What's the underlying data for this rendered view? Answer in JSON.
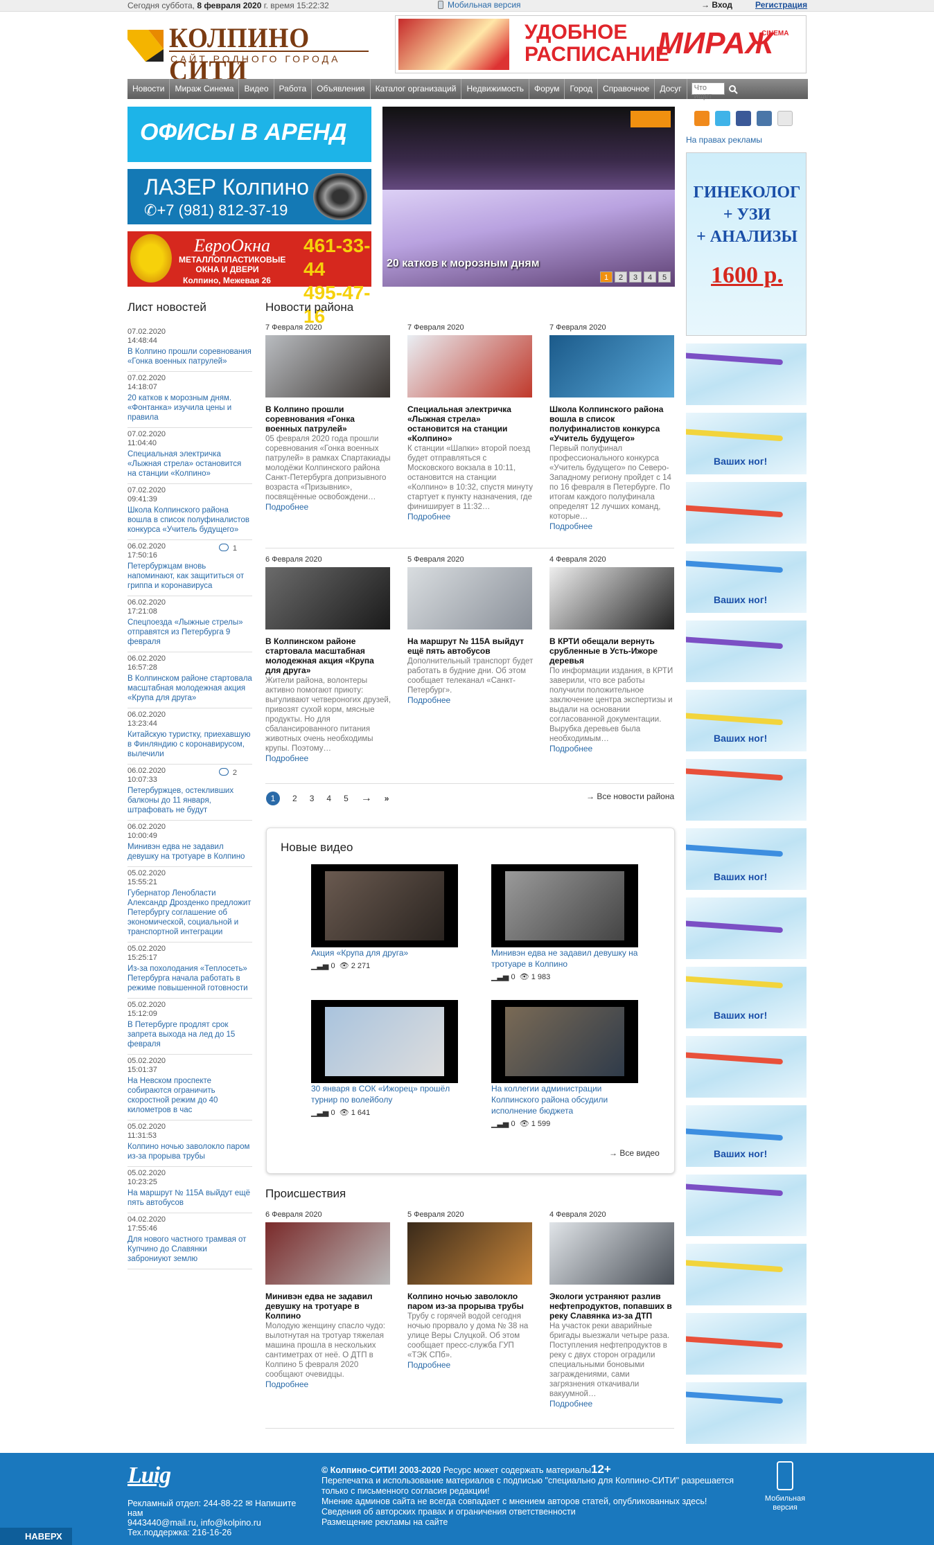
{
  "topbar": {
    "date_prefix": "Сегодня суббота, ",
    "date_bold": "8 февраля 2020",
    "date_suffix": " г. время 15:22:32",
    "mobile": "Мобильная версия",
    "login": "Вход",
    "register": "Регистрация"
  },
  "logo": {
    "title": "КОЛПИНО СИТИ",
    "subtitle": "САЙТ РОДНОГО ГОРОДА"
  },
  "top_ad": {
    "line1": "УДОБНОЕ",
    "line2": "РАСПИСАНИЕ",
    "brand": "МИРАЖ",
    "brand_small": "CINEMA"
  },
  "nav": [
    "Новости",
    "Мираж Синема",
    "Видео",
    "Работа",
    "Объявления",
    "Каталог организаций",
    "Недвижимость",
    "Форум",
    "Город",
    "Справочное",
    "Досуг"
  ],
  "search_placeholder": "Что ищет",
  "banners": {
    "b1": "ОФИСЫ В АРЕНД",
    "b2_l1": "ЛАЗЕР Колпино",
    "b2_l2": "+7 (981) 812-37-19",
    "b3_brand": "ЕвроОкна",
    "b3_text": "МЕТАЛЛОПЛАСТИКОВЫЕ ОКНА И ДВЕРИ",
    "b3_ph1": "461-33-44",
    "b3_ph2": "495-47-16",
    "b3_addr": "Колпино, Межевая 26"
  },
  "slider": {
    "caption": "20 катков к морозным дням",
    "pages": [
      "1",
      "2",
      "3",
      "4",
      "5"
    ]
  },
  "right": {
    "ad_label": "На правах рекламы",
    "ad1_lines": [
      "ГИНЕКОЛОГ",
      "+ УЗИ",
      "+ АНАЛИЗЫ"
    ],
    "ad1_price": "1600 р.",
    "tile_text": "Ваших ног!"
  },
  "left": {
    "title": "Лист новостей",
    "items": [
      {
        "date": "07.02.2020",
        "time": "14:48:44",
        "title": "В Колпино прошли соревнования «Гонка военных патрулей»",
        "comments": ""
      },
      {
        "date": "07.02.2020",
        "time": "14:18:07",
        "title": "20 катков к морозным дням. «Фонтанка» изучила цены и правила",
        "comments": ""
      },
      {
        "date": "07.02.2020",
        "time": "11:04:40",
        "title": "Специальная электричка «Лыжная стрела» остановится на станции «Колпино»",
        "comments": ""
      },
      {
        "date": "07.02.2020",
        "time": "09:41:39",
        "title": "Школа Колпинского района вошла в список полуфиналистов конкурса «Учитель будущего»",
        "comments": ""
      },
      {
        "date": "06.02.2020",
        "time": "17:50:16",
        "title": "Петербуржцам вновь напоминают, как защититься от гриппа и коронавируса",
        "comments": "1"
      },
      {
        "date": "06.02.2020",
        "time": "17:21:08",
        "title": "Спецпоезда «Лыжные стрелы» отправятся из Петербурга 9 февраля",
        "comments": ""
      },
      {
        "date": "06.02.2020",
        "time": "16:57:28",
        "title": "В Колпинском районе стартовала масштабная молодежная акция «Крупа для друга»",
        "comments": ""
      },
      {
        "date": "06.02.2020",
        "time": "13:23:44",
        "title": "Китайскую туристку, приехавшую в Финляндию с коронавирусом, вылечили",
        "comments": ""
      },
      {
        "date": "06.02.2020",
        "time": "10:07:33",
        "title": "Петербуржцев, остекливших балконы до 11 января, штрафовать не будут",
        "comments": "2"
      },
      {
        "date": "06.02.2020",
        "time": "10:00:49",
        "title": "Минивэн едва не задавил девушку на тротуаре в Колпино",
        "comments": ""
      },
      {
        "date": "05.02.2020",
        "time": "15:55:21",
        "title": "Губернатор Ленобласти Александр Дрозденко предложит Петербургу соглашение об экономической, социальной и транспортной интеграции",
        "comments": ""
      },
      {
        "date": "05.02.2020",
        "time": "15:25:17",
        "title": "Из-за похолодания «Теплосеть» Петербурга начала работать в режиме повышенной готовности",
        "comments": ""
      },
      {
        "date": "05.02.2020",
        "time": "15:12:09",
        "title": "В Петербурге продлят срок запрета выхода на лед до 15 февраля",
        "comments": ""
      },
      {
        "date": "05.02.2020",
        "time": "15:01:37",
        "title": "На Невском проспекте собираются ограничить скоростной режим до 40 километров в час",
        "comments": ""
      },
      {
        "date": "05.02.2020",
        "time": "11:31:53",
        "title": "Колпино ночью заволокло паром из-за прорыва трубы",
        "comments": ""
      },
      {
        "date": "05.02.2020",
        "time": "10:23:25",
        "title": "На маршрут № 115А выйдут ещё пять автобусов",
        "comments": ""
      },
      {
        "date": "04.02.2020",
        "time": "17:55:46",
        "title": "Для нового частного трамвая от Купчино до Славянки заброниуют землю",
        "comments": ""
      }
    ]
  },
  "district": {
    "title": "Новости района",
    "more": "Подробнее",
    "all": "Все новости района",
    "pages": [
      "2",
      "3",
      "4",
      "5",
      "→",
      "»"
    ],
    "current": "1",
    "cards": [
      {
        "date": "7 Февраля 2020",
        "title": "В Колпино прошли соревнования «Гонка военных патрулей»",
        "text": "05 февраля 2020 года прошли соревнования «Гонка военных патрулей» в рамках Спартакиады молодёжи Колпинского района Санкт-Петербурга допризывного возраста «Призывник», посвящённые освобождени…",
        "img": [
          "#b9bcc0",
          "#3a3430"
        ]
      },
      {
        "date": "7 Февраля 2020",
        "title": "Специальная электричка «Лыжная стрела» остановится на станции «Колпино»",
        "text": "К станции «Шапки» второй поезд будет отправляться с Московского вокзала в 10:11, остановится на станции «Колпино» в 10:32, спустя минуту стартует к пункту назначения, где финиширует в 11:32…",
        "img": [
          "#e9eef3",
          "#c0392b"
        ]
      },
      {
        "date": "7 Февраля 2020",
        "title": "Школа Колпинского района вошла в список полуфиналистов конкурса «Учитель будущего»",
        "text": "Первый полуфинал профессионального конкурса «Учитель будущего» по Северо-Западному региону пройдет с 14 по 16 февраля в Петербурге. По итогам каждого полуфинала определят 12 лучших команд, которые…",
        "img": [
          "#1b5a8a",
          "#59a8d8"
        ]
      },
      {
        "date": "6 Февраля 2020",
        "title": "В Колпинском районе стартовала масштабная молодежная акция «Крупа для друга»",
        "text": "Жители района, волонтеры активно помогают приюту: выгуливают четвероногих друзей, привозят сухой корм, мясные продукты. Но для сбалансированного питания животных очень необходимы крупы. Поэтому…",
        "img": [
          "#6b6b6b",
          "#1a1a1a"
        ]
      },
      {
        "date": "5 Февраля 2020",
        "title": "На маршрут № 115А выйдут ещё пять автобусов",
        "text": "Дополнительный транспорт будет работать в будние дни. Об этом сообщает телеканал «Санкт-Петербург».",
        "img": [
          "#d9dde0",
          "#8a9099"
        ]
      },
      {
        "date": "4 Февраля 2020",
        "title": "В КРТИ обещали вернуть срубленные в Усть-Ижоре деревья",
        "text": "По информации издания, в КРТИ заверили, что все работы получили положительное заключение центра экспертизы и выдали на основании согласованной документации. Вырубка деревьев была необходимым…",
        "img": [
          "#eeeeee",
          "#222222"
        ]
      }
    ]
  },
  "videos": {
    "title": "Новые видео",
    "all": "Все видео",
    "items": [
      {
        "title": "Акция «Крупа для друга»",
        "likes": "0",
        "views": "2 271",
        "img": [
          "#6a5a50",
          "#2a2420"
        ]
      },
      {
        "title": "Минивэн едва не задавил девушку на тротуаре в Колпино",
        "likes": "0",
        "views": "1 983",
        "img": [
          "#9a9a9a",
          "#444"
        ]
      },
      {
        "title": "30 января в СОК «Ижорец» прошёл турнир по волейболу",
        "likes": "0",
        "views": "1 641",
        "img": [
          "#a9c3dd",
          "#ddd"
        ]
      },
      {
        "title": "На коллегии администрации Колпинского района обсудили исполнение бюджета",
        "likes": "0",
        "views": "1 599",
        "img": [
          "#7a6a55",
          "#2f3b4a"
        ]
      }
    ]
  },
  "incidents": {
    "title": "Происшествия",
    "more": "Подробнее",
    "cards": [
      {
        "date": "6 Февраля 2020",
        "title": "Минивэн едва не задавил девушку на тротуаре в Колпино",
        "text": "Молодую женщину спасло чудо: вылотнутая на тротуар тяжелая машина прошла в нескольких сантиметрах от неё. О ДТП в Колпино 5 февраля 2020 сообщают очевидцы.",
        "img": [
          "#7a2a2a",
          "#b9b9b9"
        ]
      },
      {
        "date": "5 Февраля 2020",
        "title": "Колпино ночью заволокло паром из-за прорыва трубы",
        "text": "Трубу с горячей водой сегодня ночью прорвало у дома № 38 на улице Веры Слуцкой. Об этом сообщает пресс-служба ГУП «ТЭК СПб».",
        "img": [
          "#3a2a1a",
          "#c8863a"
        ]
      },
      {
        "date": "4 Февраля 2020",
        "title": "Экологи устраняют разлив нефтепродуктов, попавших в реку Славянка из-за ДТП",
        "text": "На участок реки аварийные бригады выезжали четыре раза. Поступления нефтепродуктов в реку с двух сторон оградили специальными боновыми заграждениями, сами загрязнения откачивали вакуумной…",
        "img": [
          "#e0e4e8",
          "#4a5058"
        ]
      }
    ]
  },
  "footer": {
    "logo": "Luig",
    "ad_dept": "Рекламный отдел: 244-88-22",
    "write": "Напишите нам",
    "emails": "9443440@mail.ru, info@kolpino.ru",
    "support": "Тех.поддержка: 216-16-26",
    "copyright": "© Колпино-СИТИ! 2003-2020",
    "cr_rest": " Ресурс может содержать материалы",
    "age": "12+",
    "lines": [
      "Перепечатка и использование материалов с подписью \"специально для Колпино-СИТИ\" разрешается только с письменного согласия редакции!",
      "Мнение админов сайта не всегда совпадает с мнением авторов статей, опубликованных здесь!",
      "Сведения об авторских правах и ограничения ответственности",
      "Размещение рекламы на сайте"
    ],
    "mobile": "Мобильная версия",
    "up": "НАВЕРХ"
  },
  "colors": {
    "link": "#2a6aa8",
    "footer": "#1a78be",
    "nav": "#6e6e6e",
    "accent": "#f09010"
  }
}
